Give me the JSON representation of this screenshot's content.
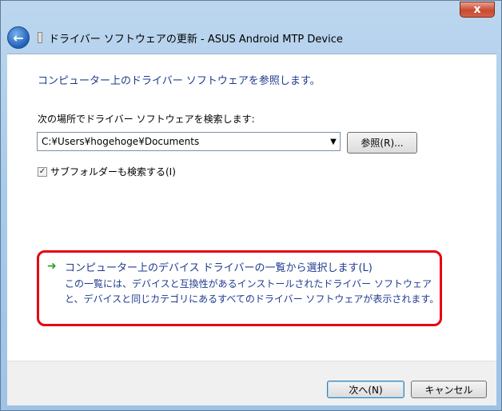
{
  "window": {
    "title": "ドライバー ソフトウェアの更新 - ASUS Android MTP Device",
    "close_label": "x"
  },
  "content": {
    "heading": "コンピューター上のドライバー ソフトウェアを参照します。",
    "location_label": "次の場所でドライバー ソフトウェアを検索します:",
    "path_value": "C:¥Users¥hogehoge¥Documents",
    "browse_label": "参照(R)...",
    "subfolder_label": "サブフォルダーも検索する(I)",
    "subfolder_checked": true,
    "link_title": "コンピューター上のデバイス ドライバーの一覧から選択します(L)",
    "link_description": "この一覧には、デバイスと互換性があるインストールされたドライバー ソフトウェアと、デバイスと同じカテゴリにあるすべてのドライバー ソフトウェアが表示されます。",
    "highlight_color": "#e60012"
  },
  "footer": {
    "next_label": "次へ(N)",
    "cancel_label": "キャンセル"
  },
  "icons": {
    "back": "back-arrow-icon",
    "device": "usb-device-icon",
    "link_arrow": "green-arrow-icon"
  }
}
